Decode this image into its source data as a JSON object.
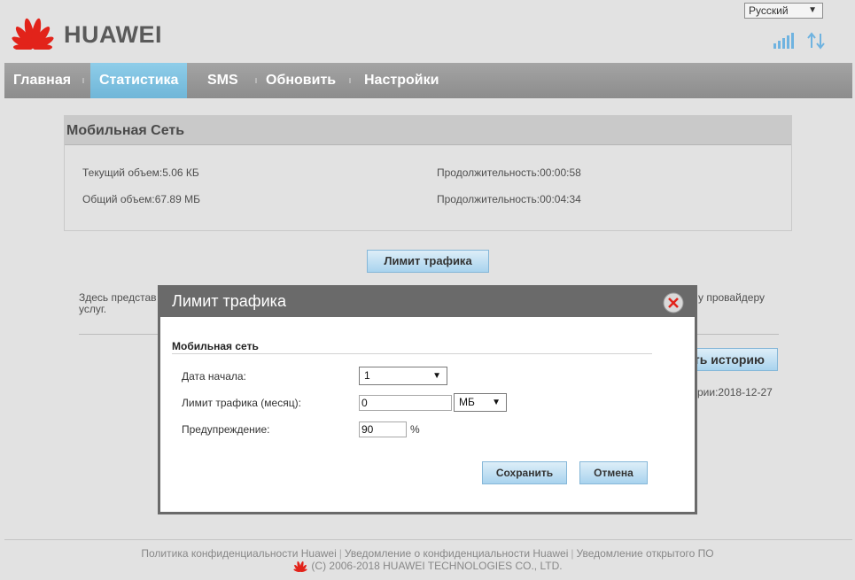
{
  "brand": {
    "name": "HUAWEI"
  },
  "language": {
    "selected": "Русский"
  },
  "nav": {
    "items": [
      {
        "label": "Главная"
      },
      {
        "label": "Статистика"
      },
      {
        "label": "SMS"
      },
      {
        "label": "Обновить"
      },
      {
        "label": "Настройки"
      }
    ],
    "active": "Статистика"
  },
  "mobile_net": {
    "title": "Мобильная Сеть",
    "current_volume": "Текущий объем:5.06 КБ",
    "current_duration": "Продолжительность:00:00:58",
    "total_volume": "Общий объем:67.89 МБ",
    "total_duration": "Продолжительность:00:04:34"
  },
  "traffic_limit_button": "Лимит трафика",
  "background": {
    "info_left_1": "Здесь представ",
    "info_left_2": "услуг.",
    "info_right": "у провайдеру",
    "history_button": "ть историю",
    "history_date": "рии:2018-12-27"
  },
  "dialog": {
    "title": "Лимит трафика",
    "section": "Мобильная сеть",
    "start_date_label": "Дата начала:",
    "start_date_value": "1",
    "limit_label": "Лимит трафика (месяц):",
    "limit_value": "0",
    "limit_unit": "МБ",
    "warning_label": "Предупреждение:",
    "warning_value": "90",
    "warning_unit": "%",
    "save": "Сохранить",
    "cancel": "Отмена"
  },
  "footer": {
    "link_privacy_policy": "Политика конфиденциальности Huawei",
    "link_privacy_notice": "Уведомление о конфиденциальности Huawei",
    "link_open_source": "Уведомление открытого ПО",
    "copyright": "(C) 2006-2018 HUAWEI TECHNOLOGIES CO., LTD."
  },
  "colors": {
    "brand_red": "#e2231a",
    "nav_active": "#7ec2e2",
    "dialog_header": "#6a6a6a",
    "button_blue": "#a9d3ee"
  },
  "icons": {
    "logo": "huawei-petal-logo",
    "signal": "signal-bars-icon",
    "data": "up-down-arrows-icon",
    "close": "close-x-icon"
  }
}
